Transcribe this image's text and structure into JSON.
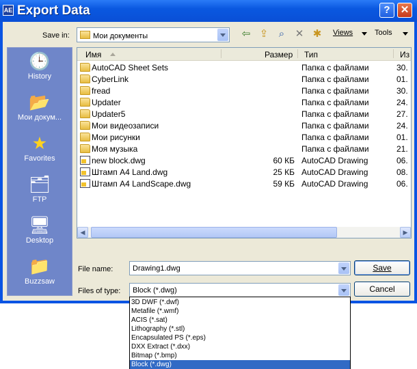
{
  "window": {
    "title": "Export Data",
    "app_icon_label": "AE",
    "help_label": "?",
    "close_label": "✕"
  },
  "toolbar": {
    "save_in_label": "Save in:",
    "save_in_value": "Мои документы",
    "views_label": "Views",
    "tools_label": "Tools"
  },
  "places": [
    {
      "label": "History",
      "icon": "history-icon"
    },
    {
      "label": "Мои докум...",
      "icon": "documents-folder-icon"
    },
    {
      "label": "Favorites",
      "icon": "star-icon"
    },
    {
      "label": "FTP",
      "icon": "ftp-icon"
    },
    {
      "label": "Desktop",
      "icon": "desktop-icon"
    },
    {
      "label": "Buzzsaw",
      "icon": "buzzsaw-icon"
    }
  ],
  "file_list": {
    "columns": {
      "name": "Имя",
      "size": "Размер",
      "type": "Тип",
      "date": "Из"
    },
    "rows": [
      {
        "name": "AutoCAD Sheet Sets",
        "size": "",
        "type": "Папка с файлами",
        "date": "30.",
        "icon": "folder-icon"
      },
      {
        "name": "CyberLink",
        "size": "",
        "type": "Папка с файлами",
        "date": "01.",
        "icon": "folder-icon"
      },
      {
        "name": "fread",
        "size": "",
        "type": "Папка с файлами",
        "date": "30.",
        "icon": "stack-folder-icon"
      },
      {
        "name": "Updater",
        "size": "",
        "type": "Папка с файлами",
        "date": "24.",
        "icon": "folder-icon"
      },
      {
        "name": "Updater5",
        "size": "",
        "type": "Папка с файлами",
        "date": "27.",
        "icon": "folder-icon"
      },
      {
        "name": "Мои видеозаписи",
        "size": "",
        "type": "Папка с файлами",
        "date": "24.",
        "icon": "video-folder-icon"
      },
      {
        "name": "Мои рисунки",
        "size": "",
        "type": "Папка с файлами",
        "date": "01.",
        "icon": "pictures-folder-icon"
      },
      {
        "name": "Моя музыка",
        "size": "",
        "type": "Папка с файлами",
        "date": "21.",
        "icon": "music-folder-icon"
      },
      {
        "name": "new block.dwg",
        "size": "60 КБ",
        "type": "AutoCAD Drawing",
        "date": "06.",
        "icon": "dwg-file-icon"
      },
      {
        "name": "Штамп А4 Land.dwg",
        "size": "25 КБ",
        "type": "AutoCAD Drawing",
        "date": "08.",
        "icon": "dwg-file-icon"
      },
      {
        "name": "Штамп А4 LandScape.dwg",
        "size": "59 КБ",
        "type": "AutoCAD Drawing",
        "date": "06.",
        "icon": "dwg-file-icon"
      }
    ]
  },
  "form": {
    "file_name_label": "File name:",
    "file_name_value": "Drawing1.dwg",
    "file_type_label": "Files of type:",
    "file_type_value": "Block (*.dwg)",
    "save_label": "Save",
    "cancel_label": "Cancel"
  },
  "file_type_options": [
    "3D DWF (*.dwf)",
    "Metafile (*.wmf)",
    "ACIS (*.sat)",
    "Lithography (*.stl)",
    "Encapsulated PS (*.eps)",
    "DXX Extract (*.dxx)",
    "Bitmap (*.bmp)",
    "Block (*.dwg)"
  ],
  "selected_option": "Block (*.dwg)",
  "colors": {
    "titlebar": "#0a54e3",
    "places_bar": "#6f86c9",
    "selection": "#316ac5"
  }
}
